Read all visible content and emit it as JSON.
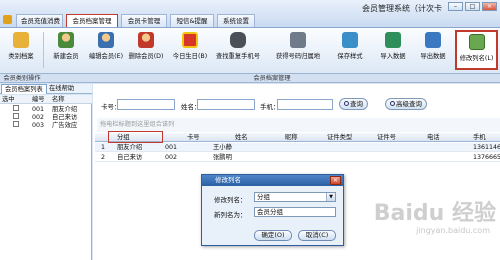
{
  "app_title": "会员管理系统（计次卡",
  "window_buttons": [
    "–",
    "□",
    "×"
  ],
  "menu_tabs": [
    "会员充值消费",
    "会员档案管理",
    "会员卡管理",
    "短信&提醒",
    "系统设置"
  ],
  "active_menu_tab": "会员档案管理",
  "toolbar": {
    "buttons": [
      {
        "label": "类别档案",
        "icon": "folder-icon"
      },
      {
        "label": "新建会员",
        "icon": "add-user-icon"
      },
      {
        "label": "编辑会员(E)",
        "icon": "edit-user-icon"
      },
      {
        "label": "删除会员(D)",
        "icon": "delete-user-icon"
      },
      {
        "label": "今日生日(B)",
        "icon": "gift-icon"
      },
      {
        "label": "查找重复手机号",
        "icon": "binoculars-icon"
      },
      {
        "label": "获得号码归属地",
        "icon": "phone-location-icon"
      },
      {
        "label": "保存样式",
        "icon": "org-chart-icon"
      },
      {
        "label": "导入数据",
        "icon": "import-icon"
      },
      {
        "label": "导出数据",
        "icon": "export-icon"
      },
      {
        "label": "修改列名(L)",
        "icon": "rename-column-icon"
      }
    ],
    "group_labels": [
      "会员类别操作",
      "会员档案管理"
    ]
  },
  "sidebar": {
    "tabs": [
      "会员档案列表",
      "在线帮助"
    ],
    "columns": [
      "选中",
      "编号",
      "名称"
    ],
    "rows": [
      {
        "code": "001",
        "name": "朋友介绍"
      },
      {
        "code": "002",
        "name": "自己来访"
      },
      {
        "code": "003",
        "name": "广告效应"
      }
    ]
  },
  "search": {
    "card_label": "卡号：",
    "name_label": "姓名：",
    "phone_label": "手机：",
    "query_button": "查询",
    "advanced_button": "高级查询"
  },
  "group_hint": "拖电栏标题到这里组合该列",
  "grid": {
    "columns": [
      "分组",
      "卡号",
      "姓名",
      "昵称",
      "证件类型",
      "证件号",
      "电话",
      "手机"
    ],
    "rows": [
      {
        "num": "1",
        "group": "朋友介绍",
        "card": "001",
        "name": "王小静",
        "mobile": "136114622"
      },
      {
        "num": "2",
        "group": "自己来访",
        "card": "002",
        "name": "张鹏明",
        "mobile": "137666566"
      }
    ]
  },
  "dialog": {
    "title": "修改列名",
    "column_label": "修改列名：",
    "column_value": "分组",
    "newname_label": "新列名为：",
    "newname_value": "会员分组",
    "ok_button": "确定(O)",
    "cancel_button": "取消(C)"
  },
  "watermark": "Baidu 经验",
  "watermark_url": "jingyan.baidu.com"
}
